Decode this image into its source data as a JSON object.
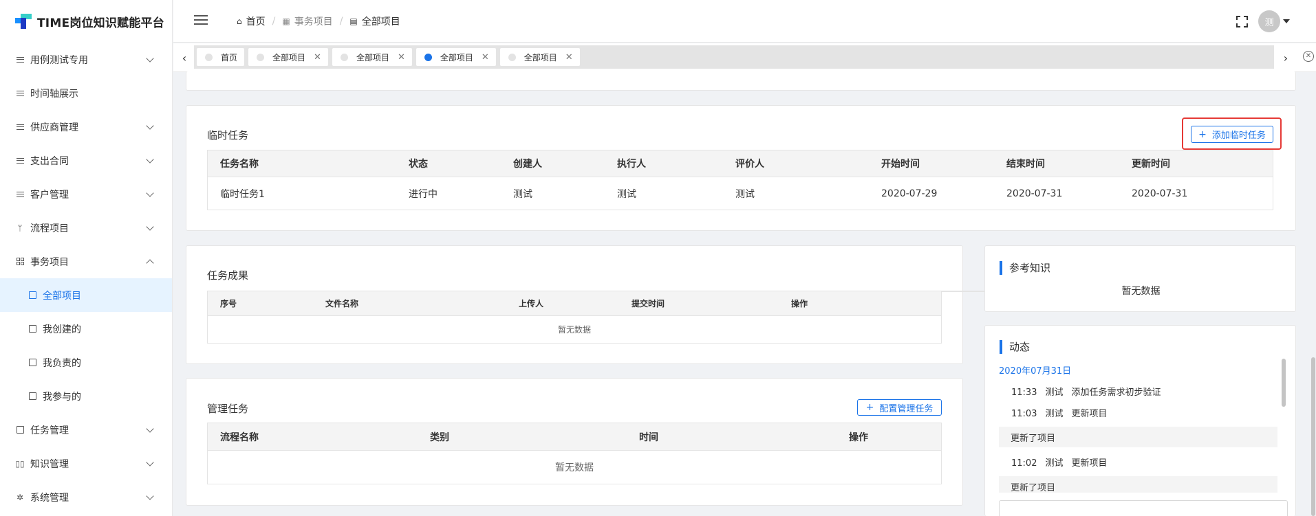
{
  "app": {
    "title": "TIME岗位知识赋能平台"
  },
  "sidebar": {
    "items": [
      {
        "label": "用例测试专用",
        "icon": "list-icon",
        "expandable": true
      },
      {
        "label": "时间轴展示",
        "icon": "list-icon",
        "expandable": false
      },
      {
        "label": "供应商管理",
        "icon": "list-icon",
        "expandable": true
      },
      {
        "label": "支出合同",
        "icon": "list-icon",
        "expandable": true
      },
      {
        "label": "客户管理",
        "icon": "list-icon",
        "expandable": true
      },
      {
        "label": "流程项目",
        "icon": "branch-icon",
        "expandable": true
      },
      {
        "label": "事务项目",
        "icon": "grid-icon",
        "expandable": true,
        "expanded": true
      },
      {
        "label": "任务管理",
        "icon": "checkbox-icon",
        "expandable": true
      },
      {
        "label": "知识管理",
        "icon": "book-icon",
        "expandable": true
      },
      {
        "label": "系统管理",
        "icon": "gear-icon",
        "expandable": true
      }
    ],
    "submenu": [
      {
        "label": "全部项目",
        "icon": "doc-icon",
        "active": true
      },
      {
        "label": "我创建的",
        "icon": "plus-square-icon"
      },
      {
        "label": "我负责的",
        "icon": "check-square-icon"
      },
      {
        "label": "我参与的",
        "icon": "play-square-icon"
      }
    ]
  },
  "header": {
    "breadcrumb": [
      {
        "label": "首页",
        "icon": "home-icon"
      },
      {
        "label": "事务项目",
        "icon": "grid-icon"
      },
      {
        "label": "全部项目",
        "icon": "doc-icon"
      }
    ],
    "avatar_text": "测"
  },
  "tabs": [
    {
      "label": "首页",
      "closable": false,
      "active": false
    },
    {
      "label": "全部项目",
      "closable": true,
      "active": false
    },
    {
      "label": "全部项目",
      "closable": true,
      "active": false
    },
    {
      "label": "全部项目",
      "closable": true,
      "active": true
    },
    {
      "label": "全部项目",
      "closable": true,
      "active": false
    }
  ],
  "temp_tasks": {
    "title": "临时任务",
    "add_button": "添加临时任务",
    "columns": [
      "任务名称",
      "状态",
      "创建人",
      "执行人",
      "评价人",
      "开始时间",
      "结束时间",
      "更新时间"
    ],
    "rows": [
      [
        "临时任务1",
        "进行中",
        "测试",
        "测试",
        "测试",
        "2020-07-29",
        "2020-07-31",
        "2020-07-31"
      ]
    ]
  },
  "task_results": {
    "title": "任务成果",
    "columns": [
      "序号",
      "文件名称",
      "上传人",
      "提交时间",
      "操作"
    ],
    "empty_text": "暂无数据"
  },
  "manage_tasks": {
    "title": "管理任务",
    "config_button": "配置管理任务",
    "columns": [
      "流程名称",
      "类别",
      "时间",
      "操作"
    ],
    "empty_text": "暂无数据"
  },
  "reference": {
    "title": "参考知识",
    "empty_text": "暂无数据"
  },
  "activity": {
    "title": "动态",
    "date": "2020年07月31日",
    "entries": [
      {
        "time": "11:33",
        "user": "测试",
        "action": "添加任务需求初步验证"
      },
      {
        "time": "11:03",
        "user": "测试",
        "action": "更新项目"
      }
    ],
    "block1": "更新了项目",
    "entry3": {
      "time": "11:02",
      "user": "测试",
      "action": "更新项目"
    },
    "block2": "更新了项目"
  },
  "colors": {
    "accent": "#1a73e8",
    "highlight": "#e53935"
  }
}
